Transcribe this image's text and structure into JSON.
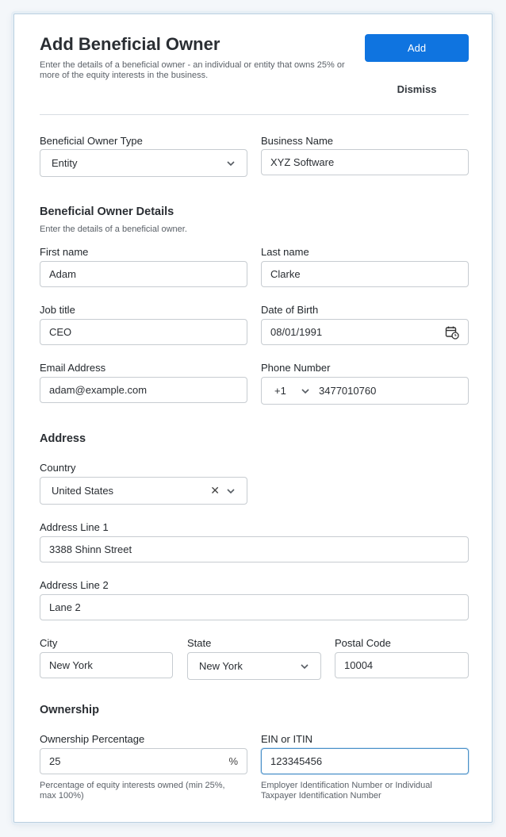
{
  "header": {
    "title": "Add Beneficial Owner",
    "subtitle": "Enter the details of a beneficial owner - an individual or entity that owns 25% or more of the equity interests in the business.",
    "add_label": "Add",
    "dismiss_label": "Dismiss"
  },
  "owner_type": {
    "label": "Beneficial Owner Type",
    "value": "Entity"
  },
  "business_name": {
    "label": "Business Name",
    "value": "XYZ Software"
  },
  "details": {
    "heading": "Beneficial Owner Details",
    "hint": "Enter the details of a beneficial owner.",
    "first_name": {
      "label": "First name",
      "value": "Adam"
    },
    "last_name": {
      "label": "Last name",
      "value": "Clarke"
    },
    "job_title": {
      "label": "Job title",
      "value": "CEO"
    },
    "dob": {
      "label": "Date of Birth",
      "value": "08/01/1991",
      "icon": "calendar-clock-icon"
    },
    "email": {
      "label": "Email Address",
      "value": "adam@example.com"
    },
    "phone": {
      "label": "Phone Number",
      "code": "+1",
      "value": "3477010760"
    }
  },
  "address": {
    "heading": "Address",
    "country": {
      "label": "Country",
      "value": "United States"
    },
    "line1": {
      "label": "Address Line 1",
      "value": "3388 Shinn Street"
    },
    "line2": {
      "label": "Address Line 2",
      "value": "Lane 2"
    },
    "city": {
      "label": "City",
      "value": "New York"
    },
    "state": {
      "label": "State",
      "value": "New York"
    },
    "postal": {
      "label": "Postal Code",
      "value": "10004"
    }
  },
  "ownership": {
    "heading": "Ownership",
    "percentage": {
      "label": "Ownership Percentage",
      "value": "25",
      "suffix": "%",
      "hint": "Percentage of equity interests owned (min 25%, max 100%)"
    },
    "ein": {
      "label": "EIN or ITIN",
      "value": "123345456",
      "hint": "Employer Identification Number or Individual Taxpayer Identification Number"
    }
  },
  "colors": {
    "primary": "#0f74e0",
    "focus_border": "#4a90c8"
  }
}
